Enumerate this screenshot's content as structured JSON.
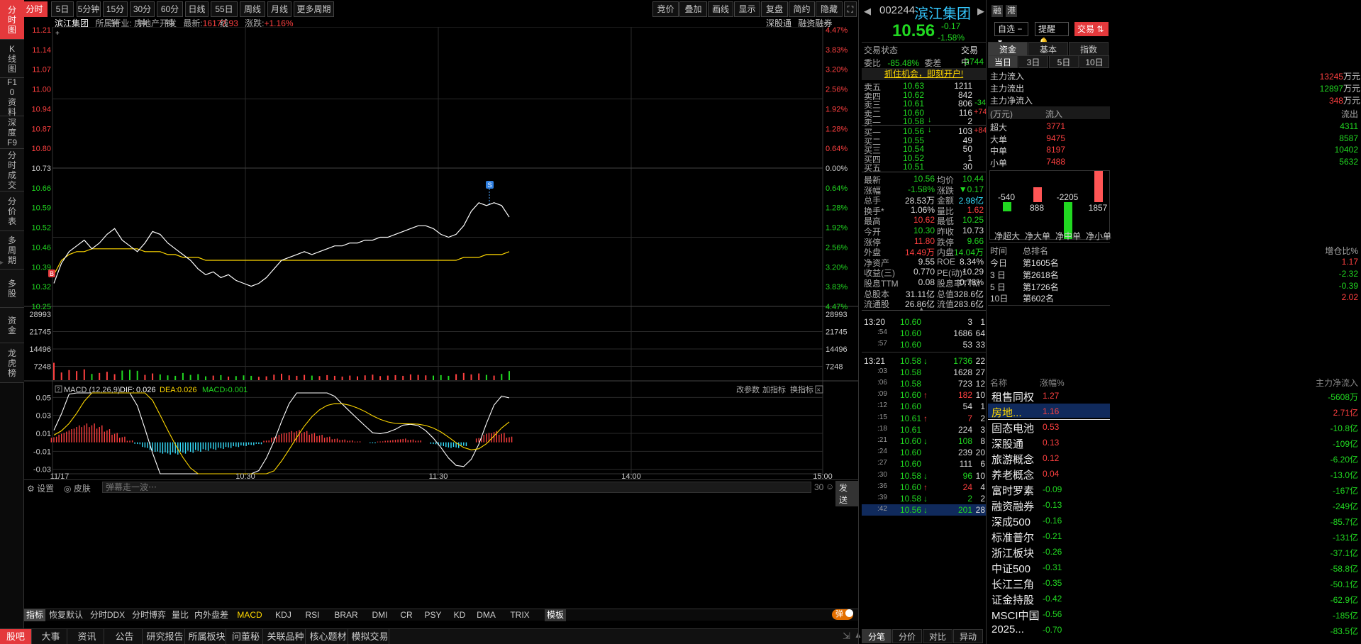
{
  "sidebar": {
    "tabs": [
      {
        "label": "分时图",
        "active": true
      },
      {
        "label": "K线图"
      },
      {
        "label": "F10资料"
      },
      {
        "label": "深度F9"
      },
      {
        "label": "分时成交"
      },
      {
        "label": "分价表"
      },
      {
        "label": "多周期"
      },
      {
        "label": "多股"
      },
      {
        "label": "资金"
      },
      {
        "label": "龙虎榜"
      }
    ]
  },
  "toolbar": {
    "periods": [
      "分时",
      "5日",
      "5分钟",
      "15分钟",
      "30分钟",
      "60分钟",
      "日线",
      "55日线",
      "周线",
      "月线",
      "更多周期"
    ],
    "right_buttons": [
      "竞价",
      "叠加",
      "画线",
      "显示",
      "复盘",
      "简约",
      "隐藏"
    ]
  },
  "chart_header": {
    "name": "滨江集团",
    "industry_label": "所属行业:",
    "industry": "房地产开发",
    "latest_label": "最新:",
    "latest": "16177.93",
    "change_label": "涨跌:",
    "change": "+1.16%",
    "links": [
      "深股通",
      "融资融券"
    ]
  },
  "chart_data": [
    {
      "type": "line",
      "name": "intraday-price",
      "y_ticks_left": [
        "11.21",
        "11.14",
        "11.07",
        "11.00",
        "10.94",
        "10.87",
        "10.80",
        "10.73",
        "10.66",
        "10.59",
        "10.52",
        "10.46",
        "10.39",
        "10.32",
        "10.25"
      ],
      "y_ticks_right": [
        "4.47%",
        "3.83%",
        "3.20%",
        "2.56%",
        "1.92%",
        "1.28%",
        "0.64%",
        "0.00%",
        "0.64%",
        "1.28%",
        "1.92%",
        "2.56%",
        "3.20%",
        "3.83%",
        "4.47%"
      ],
      "x_ticks": [
        "11/17",
        "10:30",
        "11:30",
        "14:00",
        "15:00"
      ],
      "ylim": [
        10.25,
        11.21
      ],
      "reference": 10.73,
      "series": [
        {
          "values": [
            10.33,
            10.4,
            10.44,
            10.46,
            10.48,
            10.45,
            10.47,
            10.5,
            10.52,
            10.48,
            10.46,
            10.44,
            10.47,
            10.51,
            10.5,
            10.47,
            10.45,
            10.43,
            10.41,
            10.38,
            10.36,
            10.37,
            10.35,
            10.36,
            10.34,
            10.33,
            10.32,
            10.33,
            10.35,
            10.38,
            10.41,
            10.42,
            10.43,
            10.44,
            10.43,
            10.44,
            10.45,
            10.46,
            10.46,
            10.47,
            10.47,
            10.48,
            10.48,
            10.49,
            10.49,
            10.5,
            10.51,
            10.52,
            10.53,
            10.53,
            10.52,
            10.5,
            10.49,
            10.5,
            10.53,
            10.58,
            10.61,
            10.6,
            10.61,
            10.6,
            10.56
          ]
        },
        {
          "values": [
            10.36,
            10.41,
            10.43,
            10.44,
            10.44,
            10.45,
            10.45,
            10.45,
            10.45,
            10.45,
            10.45,
            10.45,
            10.44,
            10.44,
            10.44,
            10.43,
            10.43,
            10.42,
            10.42,
            10.42,
            10.41,
            10.41,
            10.41,
            10.41,
            10.41,
            10.41,
            10.41,
            10.41,
            10.41,
            10.41,
            10.41,
            10.41,
            10.41,
            10.41,
            10.41,
            10.41,
            10.41,
            10.41,
            10.41,
            10.41,
            10.41,
            10.41,
            10.41,
            10.41,
            10.41,
            10.41,
            10.41,
            10.41,
            10.41,
            10.41,
            10.41,
            10.41,
            10.41,
            10.41,
            10.42,
            10.42,
            10.42,
            10.43,
            10.43,
            10.43,
            10.44
          ]
        }
      ],
      "markers": [
        "B",
        "S"
      ]
    },
    {
      "type": "bar",
      "name": "volume",
      "y_ticks": [
        "28993",
        "21745",
        "14496",
        "7248"
      ],
      "ylim": [
        0,
        28993
      ],
      "values": [
        7248,
        3200,
        4200,
        3800,
        4500,
        2600,
        3000,
        3500,
        2500,
        4000,
        4300,
        3900,
        2200,
        2800,
        2400,
        2000,
        1800,
        3000,
        2200,
        2500,
        1600,
        1900,
        2100,
        1500,
        1700,
        2000,
        1800,
        1400,
        1600,
        2300,
        2700,
        2000,
        1800,
        2200,
        1900,
        1700,
        2100,
        1800,
        1500,
        1900,
        1600,
        2000,
        2300,
        1700,
        1900,
        2100,
        1800,
        2400,
        2200,
        2000,
        1900,
        2100,
        1800,
        2500,
        3000,
        2400,
        2800,
        2200,
        1900,
        2600,
        3800
      ]
    },
    {
      "type": "bar",
      "name": "macd",
      "title": "MACD (12,26,9)",
      "y_ticks": [
        "0.05",
        "0.03",
        "0.01",
        "-0.01",
        "-0.03"
      ],
      "ylim": [
        -0.035,
        0.055
      ],
      "dif": "0.026",
      "dea": "0.026",
      "macd": "-0.001",
      "values": [
        0.006,
        0.01,
        0.014,
        0.018,
        0.02,
        0.02,
        0.018,
        0.014,
        0.01,
        0.006,
        0.002,
        -0.002,
        -0.006,
        -0.01,
        -0.012,
        -0.013,
        -0.013,
        -0.012,
        -0.011,
        -0.01,
        -0.009,
        -0.008,
        -0.007,
        -0.006,
        -0.005,
        -0.004,
        -0.003,
        -0.002,
        0.002,
        0.006,
        0.01,
        0.012,
        0.013,
        0.012,
        0.01,
        0.008,
        0.006,
        0.004,
        0.003,
        0.002,
        0.001,
        0.0,
        -0.001,
        0.001,
        0.002,
        0.003,
        0.004,
        0.003,
        0.002,
        0.0,
        -0.002,
        -0.004,
        -0.006,
        -0.006,
        -0.004,
        0.0,
        0.005,
        0.01,
        0.012,
        0.01,
        0.006
      ]
    }
  ],
  "chart_footer": {
    "settings": "设置",
    "skin": "皮肤",
    "danmu_placeholder": "弹幕走一波⋯",
    "count": "30",
    "send": "发送",
    "macd_links": [
      "改参数",
      "加指标",
      "换指标"
    ]
  },
  "indicator_tabs": [
    "指标",
    "恢复默认",
    "分时DDX",
    "分时博弈",
    "量比",
    "内外盘差",
    "MACD",
    "KDJ",
    "RSI",
    "BRAR",
    "DMI",
    "CR",
    "PSY",
    "KD",
    "DMA",
    "TRIX",
    "模板"
  ],
  "toggle_label": "弹",
  "bottom_tabs": [
    "股吧",
    "大事",
    "资讯",
    "公告",
    "研究报告",
    "所属板块",
    "问董秘",
    "关联品种",
    "核心题材",
    "模拟交易"
  ],
  "quote": {
    "code": "002244",
    "name": "滨江集团",
    "tags": [
      "融",
      "港"
    ],
    "price": "10.56",
    "change": "-0.17",
    "change_pct": "-1.58%",
    "buttons": [
      "自选",
      "提醒",
      "交易"
    ]
  },
  "trade_status": {
    "label": "交易状态",
    "value": "交易中"
  },
  "weibi": {
    "label": "委比",
    "value": "-85.48%",
    "diff_label": "委差",
    "diff": "-2744"
  },
  "promo": "抓住机会，即刻开户!",
  "asks": [
    {
      "label": "卖五",
      "price": "10.63",
      "vol": "1211",
      "chg": ""
    },
    {
      "label": "卖四",
      "price": "10.62",
      "vol": "842",
      "chg": ""
    },
    {
      "label": "卖三",
      "price": "10.61",
      "vol": "806",
      "chg": "-34"
    },
    {
      "label": "卖二",
      "price": "10.60",
      "vol": "116",
      "chg": "+74"
    },
    {
      "label": "卖一",
      "price": "10.58",
      "vol": "2",
      "chg": ""
    }
  ],
  "bids": [
    {
      "label": "买一",
      "price": "10.56",
      "vol": "103",
      "chg": "+84"
    },
    {
      "label": "买二",
      "price": "10.55",
      "vol": "49",
      "chg": ""
    },
    {
      "label": "买三",
      "price": "10.54",
      "vol": "50",
      "chg": ""
    },
    {
      "label": "买四",
      "price": "10.52",
      "vol": "1",
      "chg": ""
    },
    {
      "label": "买五",
      "price": "10.51",
      "vol": "30",
      "chg": ""
    }
  ],
  "stats": [
    [
      "最新",
      "10.56",
      "均价",
      "10.44"
    ],
    [
      "涨幅",
      "-1.58%",
      "涨跌",
      "▼0.17"
    ],
    [
      "总手",
      "28.53万",
      "金额",
      "2.98亿"
    ],
    [
      "换手*",
      "1.06%",
      "量比",
      "1.62"
    ],
    [
      "最高",
      "10.62",
      "最低",
      "10.25"
    ],
    [
      "今开",
      "10.30",
      "昨收",
      "10.73"
    ],
    [
      "涨停",
      "11.80",
      "跌停",
      "9.66"
    ],
    [
      "外盘",
      "14.49万",
      "内盘",
      "14.04万"
    ],
    [
      "净资产",
      "9.55",
      "ROE",
      "8.34%"
    ],
    [
      "收益(三)",
      "0.770",
      "PE(动)*",
      "10.29"
    ],
    [
      "股息TTM",
      "0.08",
      "股息率TTM",
      "0.78%"
    ],
    [
      "总股本",
      "31.11亿",
      "总值",
      "328.6亿"
    ],
    [
      "流通股",
      "26.86亿",
      "流值",
      "283.6亿"
    ]
  ],
  "ticks": [
    {
      "time": "13:20",
      "price": "10.60",
      "vol": "3",
      "n": "1",
      "dir": ""
    },
    {
      "time": ":54",
      "price": "10.60",
      "vol": "1686",
      "n": "64",
      "dir": ""
    },
    {
      "time": ":57",
      "price": "10.60",
      "vol": "53",
      "n": "33",
      "dir": ""
    },
    {
      "time": "13:21",
      "price": "10.58",
      "vol": "1736",
      "n": "22",
      "dir": "down"
    },
    {
      "time": ":03",
      "price": "10.58",
      "vol": "1628",
      "n": "27",
      "dir": ""
    },
    {
      "time": ":06",
      "price": "10.58",
      "vol": "723",
      "n": "12",
      "dir": ""
    },
    {
      "time": ":09",
      "price": "10.60",
      "vol": "182",
      "n": "10",
      "dir": "up"
    },
    {
      "time": ":12",
      "price": "10.60",
      "vol": "54",
      "n": "1",
      "dir": ""
    },
    {
      "time": ":15",
      "price": "10.61",
      "vol": "7",
      "n": "2",
      "dir": "up"
    },
    {
      "time": ":18",
      "price": "10.61",
      "vol": "224",
      "n": "3",
      "dir": ""
    },
    {
      "time": ":21",
      "price": "10.60",
      "vol": "108",
      "n": "8",
      "dir": "down"
    },
    {
      "time": ":24",
      "price": "10.60",
      "vol": "239",
      "n": "20",
      "dir": ""
    },
    {
      "time": ":27",
      "price": "10.60",
      "vol": "111",
      "n": "6",
      "dir": ""
    },
    {
      "time": ":30",
      "price": "10.58",
      "vol": "96",
      "n": "10",
      "dir": "down"
    },
    {
      "time": ":36",
      "price": "10.60",
      "vol": "24",
      "n": "4",
      "dir": "up"
    },
    {
      "time": ":39",
      "price": "10.58",
      "vol": "2",
      "n": "2",
      "dir": "down"
    },
    {
      "time": ":42",
      "price": "10.56",
      "vol": "201",
      "n": "28",
      "dir": "down"
    }
  ],
  "tick_tabs": [
    "分笔",
    "分价",
    "对比",
    "异动"
  ],
  "fund": {
    "tabs": [
      "资金",
      "基本",
      "指数"
    ],
    "day_tabs": [
      "当日",
      "3日",
      "5日",
      "10日"
    ],
    "main_in": {
      "label": "主力流入",
      "value": "13245",
      "unit": "万元"
    },
    "main_out": {
      "label": "主力流出",
      "value": "12897",
      "unit": "万元"
    },
    "main_net": {
      "label": "主力净流入",
      "value": "348",
      "unit": "万元"
    },
    "unit": "(万元)",
    "col_in": "流入",
    "col_out": "流出",
    "rows": [
      {
        "label": "超大",
        "in": "3771",
        "out": "4311"
      },
      {
        "label": "大单",
        "in": "9475",
        "out": "8587"
      },
      {
        "label": "中单",
        "in": "8197",
        "out": "10402"
      },
      {
        "label": "小单",
        "in": "7488",
        "out": "5632"
      }
    ],
    "net_bars": [
      {
        "label": "净超大",
        "value": -540
      },
      {
        "label": "净大单",
        "value": 888
      },
      {
        "label": "净中单",
        "value": -2205
      },
      {
        "label": "净小单",
        "value": 1857
      }
    ],
    "rank_head": [
      "时间",
      "总排名",
      "增仓比%"
    ],
    "ranks": [
      {
        "period": "今日",
        "rank": "第1605名",
        "pct": "1.17"
      },
      {
        "period": "3 日",
        "rank": "第2618名",
        "pct": "-2.32"
      },
      {
        "period": "5 日",
        "rank": "第1726名",
        "pct": "-0.39"
      },
      {
        "period": "10日",
        "rank": "第602名",
        "pct": "2.02"
      }
    ],
    "sector_head": [
      "名称",
      "涨幅%",
      "主力净流入"
    ],
    "sectors": [
      {
        "name": "租售同权",
        "pct": "1.27",
        "flow": "-5608万"
      },
      {
        "name": "房地...",
        "pct": "1.16",
        "flow": "2.71亿"
      },
      {
        "name": "固态电池",
        "pct": "0.53",
        "flow": "-10.8亿"
      },
      {
        "name": "深股通",
        "pct": "0.13",
        "flow": "-109亿"
      },
      {
        "name": "旅游概念",
        "pct": "0.12",
        "flow": "-6.20亿"
      },
      {
        "name": "养老概念",
        "pct": "0.04",
        "flow": "-13.0亿"
      },
      {
        "name": "富时罗素",
        "pct": "-0.09",
        "flow": "-167亿"
      },
      {
        "name": "融资融券",
        "pct": "-0.13",
        "flow": "-249亿"
      },
      {
        "name": "深成500",
        "pct": "-0.16",
        "flow": "-85.7亿"
      },
      {
        "name": "标准普尔",
        "pct": "-0.21",
        "flow": "-131亿"
      },
      {
        "name": "浙江板块",
        "pct": "-0.26",
        "flow": "-37.1亿"
      },
      {
        "name": "中证500",
        "pct": "-0.31",
        "flow": "-58.8亿"
      },
      {
        "name": "长江三角",
        "pct": "-0.35",
        "flow": "-50.1亿"
      },
      {
        "name": "证金持股",
        "pct": "-0.42",
        "flow": "-62.9亿"
      },
      {
        "name": "MSCI中国",
        "pct": "-0.56",
        "flow": "-185亿"
      },
      {
        "name": "2025...",
        "pct": "-0.70",
        "flow": "-83.5亿"
      }
    ]
  },
  "colors": {
    "up": "#ff4040",
    "down": "#21d821",
    "accent": "#e4393c",
    "price_line": "#ffffff",
    "avg_line": "#ffd800"
  }
}
